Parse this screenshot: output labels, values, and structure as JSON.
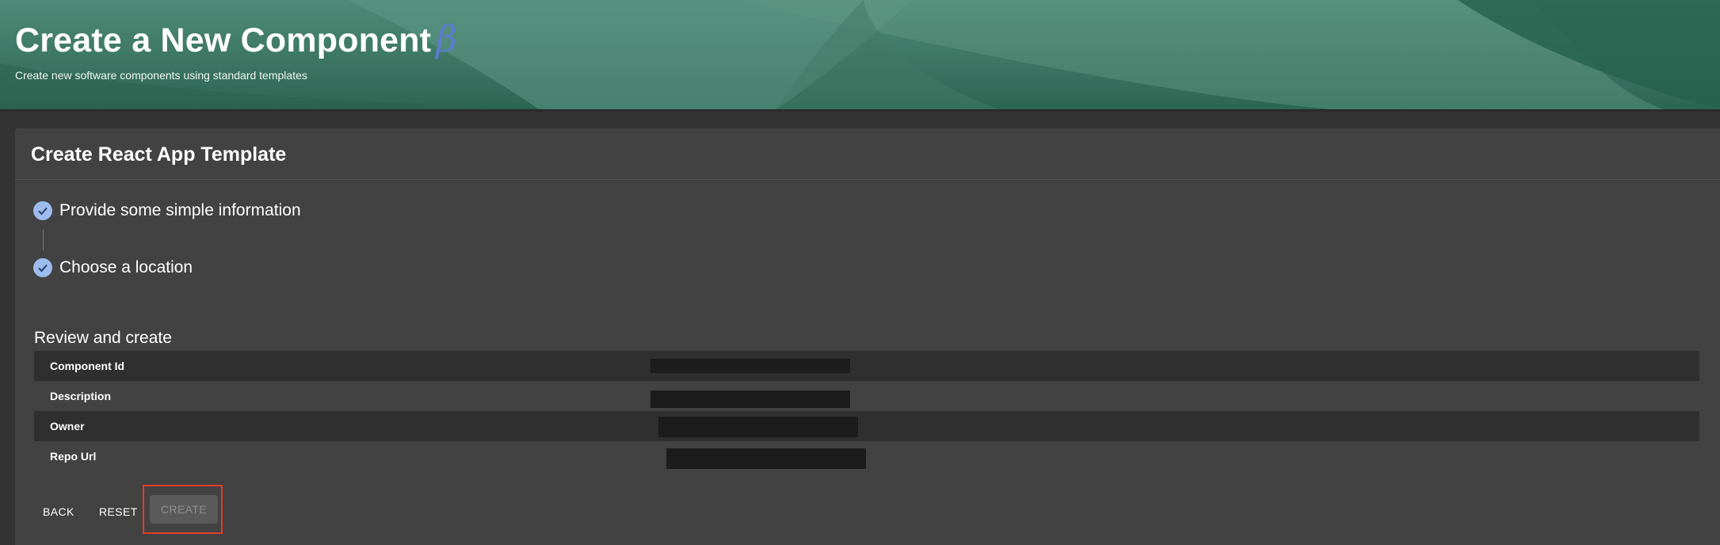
{
  "header": {
    "title": "Create a New Component",
    "beta_symbol": "β",
    "subtitle": "Create new software components using standard templates"
  },
  "card": {
    "title": "Create React App Template"
  },
  "steps": [
    {
      "label": "Provide some simple information",
      "status": "completed",
      "icon": "check-icon"
    },
    {
      "label": "Choose a location",
      "status": "completed",
      "icon": "check-icon"
    }
  ],
  "review": {
    "title": "Review and create",
    "rows": [
      {
        "label": "Component Id",
        "value": ""
      },
      {
        "label": "Description",
        "value": ""
      },
      {
        "label": "Owner",
        "value": ""
      },
      {
        "label": "Repo Url",
        "value": ""
      }
    ]
  },
  "actions": {
    "back_label": "BACK",
    "reset_label": "RESET",
    "create_label": "CREATE"
  },
  "colors": {
    "header_green": "#2f6f5a",
    "beta_blue": "#5b7ccf",
    "step_icon": "#9cbcee",
    "highlight_red": "#e53c2b",
    "card_bg": "#424242",
    "page_bg": "#333333"
  }
}
